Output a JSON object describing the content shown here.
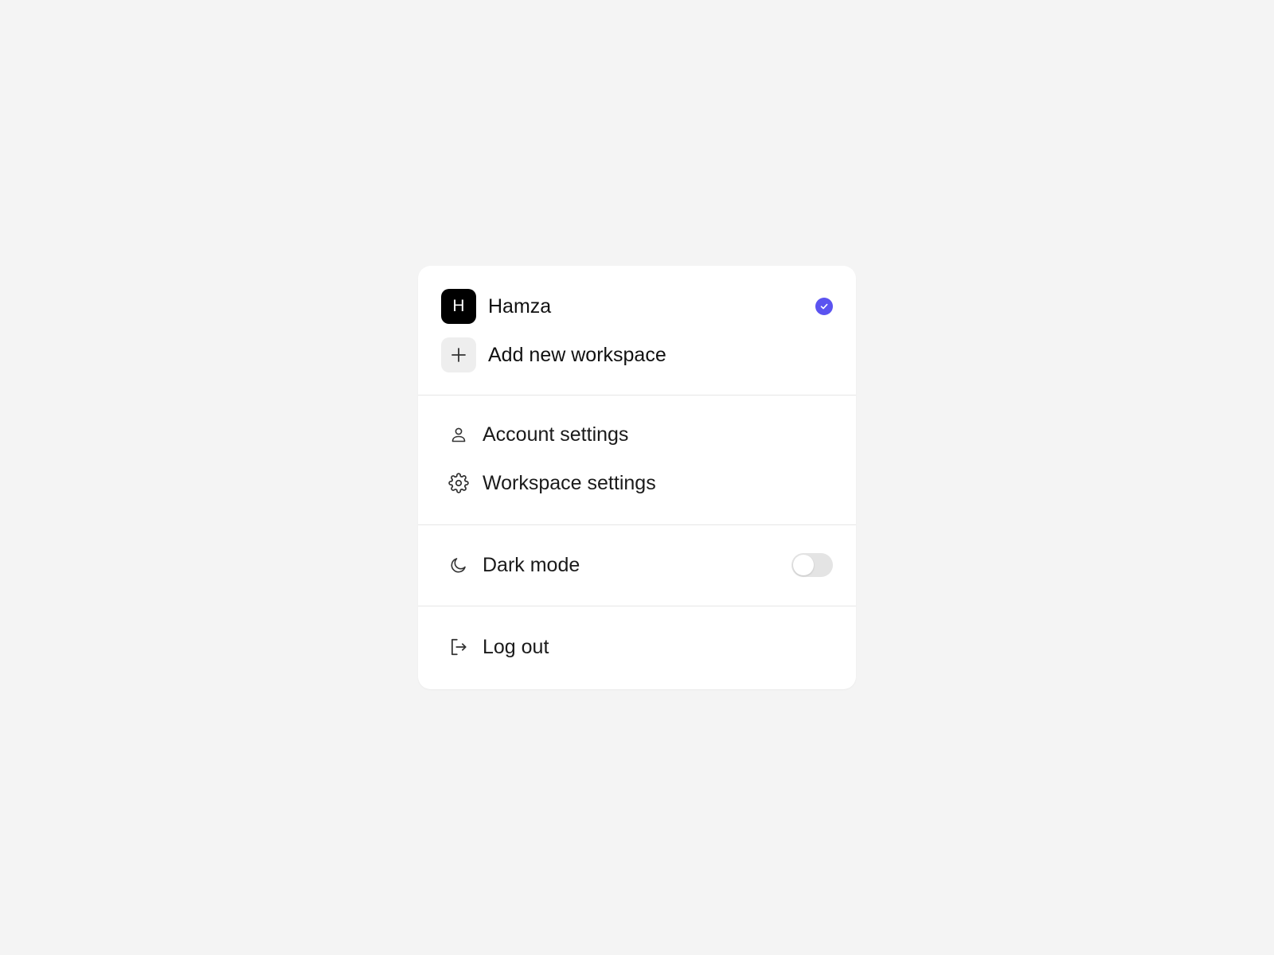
{
  "workspaces": [
    {
      "initial": "H",
      "name": "Hamza",
      "selected": true,
      "avatar_color": "#000000"
    }
  ],
  "add_workspace": {
    "label": "Add new workspace",
    "icon": "plus-icon"
  },
  "settings": {
    "account": {
      "label": "Account settings",
      "icon": "user-icon"
    },
    "workspace": {
      "label": "Workspace settings",
      "icon": "gear-icon"
    }
  },
  "dark_mode": {
    "label": "Dark mode",
    "icon": "moon-icon",
    "enabled": false
  },
  "logout": {
    "label": "Log out",
    "icon": "logout-icon"
  },
  "colors": {
    "accent": "#5b53f0",
    "background": "#f4f4f4",
    "panel": "#ffffff",
    "divider": "#e6e6e6"
  }
}
